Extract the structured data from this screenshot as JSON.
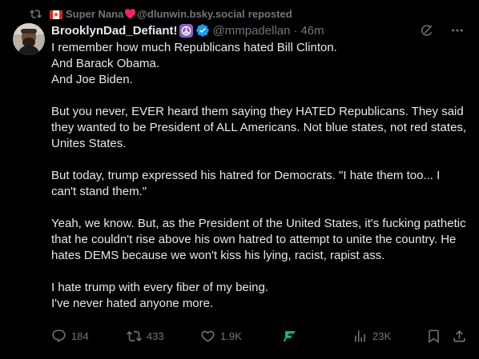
{
  "repost": {
    "reposter_name": "Super Nana",
    "reposter_handle": "@dlunwin.bsky.social",
    "suffix": "reposted",
    "icons": [
      "repost-icon",
      "canada-flag-icon",
      "red-heart-icon"
    ]
  },
  "author": {
    "display_name": "BrooklynDad_Defiant!",
    "handle": "@mmpadellan",
    "separator": "·",
    "time": "46m",
    "badges": [
      "peace-sign-emoji",
      "verified-badge-icon"
    ],
    "verified_color": "#1d9bf0"
  },
  "post": {
    "paragraphs": [
      "I remember how much Republicans hated Bill Clinton.\nAnd Barack Obama.\nAnd Joe Biden.",
      "But you never, EVER heard them saying they HATED Republicans. They said they wanted to be President of ALL Americans. Not blue states, not red states, Unites States.",
      "But today, trump expressed his hatred for Democrats. \"I hate them too... I can't stand them.\"",
      "Yeah, we know. But, as the President of the United States, it's fucking pathetic that he couldn't rise above his own hatred to attempt to unite the country. He hates DEMS because we won't kiss his lying, racist, rapist ass.",
      "I hate trump with every fiber of my being.\nI've never hated anyone more."
    ]
  },
  "actions": {
    "replies": "184",
    "reposts": "433",
    "likes": "1.9K",
    "views": "23K",
    "icons": [
      "reply-icon",
      "repost-icon",
      "heart-icon",
      "grok-icon",
      "views-icon",
      "bookmark-icon",
      "share-icon"
    ]
  },
  "colors": {
    "background": "#000000",
    "text": "#e7e9ea",
    "secondary": "#71767b",
    "accent_green": "#00ba7c"
  }
}
